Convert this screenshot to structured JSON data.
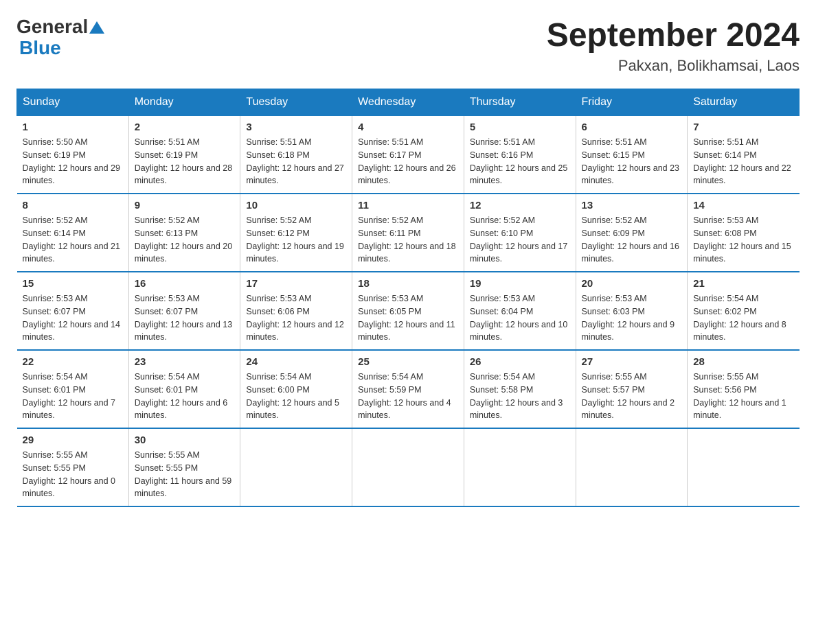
{
  "header": {
    "logo_general": "General",
    "logo_blue": "Blue",
    "title": "September 2024",
    "subtitle": "Pakxan, Bolikhamsai, Laos"
  },
  "days_of_week": [
    "Sunday",
    "Monday",
    "Tuesday",
    "Wednesday",
    "Thursday",
    "Friday",
    "Saturday"
  ],
  "weeks": [
    [
      {
        "day": "1",
        "sunrise": "5:50 AM",
        "sunset": "6:19 PM",
        "daylight": "12 hours and 29 minutes."
      },
      {
        "day": "2",
        "sunrise": "5:51 AM",
        "sunset": "6:19 PM",
        "daylight": "12 hours and 28 minutes."
      },
      {
        "day": "3",
        "sunrise": "5:51 AM",
        "sunset": "6:18 PM",
        "daylight": "12 hours and 27 minutes."
      },
      {
        "day": "4",
        "sunrise": "5:51 AM",
        "sunset": "6:17 PM",
        "daylight": "12 hours and 26 minutes."
      },
      {
        "day": "5",
        "sunrise": "5:51 AM",
        "sunset": "6:16 PM",
        "daylight": "12 hours and 25 minutes."
      },
      {
        "day": "6",
        "sunrise": "5:51 AM",
        "sunset": "6:15 PM",
        "daylight": "12 hours and 23 minutes."
      },
      {
        "day": "7",
        "sunrise": "5:51 AM",
        "sunset": "6:14 PM",
        "daylight": "12 hours and 22 minutes."
      }
    ],
    [
      {
        "day": "8",
        "sunrise": "5:52 AM",
        "sunset": "6:14 PM",
        "daylight": "12 hours and 21 minutes."
      },
      {
        "day": "9",
        "sunrise": "5:52 AM",
        "sunset": "6:13 PM",
        "daylight": "12 hours and 20 minutes."
      },
      {
        "day": "10",
        "sunrise": "5:52 AM",
        "sunset": "6:12 PM",
        "daylight": "12 hours and 19 minutes."
      },
      {
        "day": "11",
        "sunrise": "5:52 AM",
        "sunset": "6:11 PM",
        "daylight": "12 hours and 18 minutes."
      },
      {
        "day": "12",
        "sunrise": "5:52 AM",
        "sunset": "6:10 PM",
        "daylight": "12 hours and 17 minutes."
      },
      {
        "day": "13",
        "sunrise": "5:52 AM",
        "sunset": "6:09 PM",
        "daylight": "12 hours and 16 minutes."
      },
      {
        "day": "14",
        "sunrise": "5:53 AM",
        "sunset": "6:08 PM",
        "daylight": "12 hours and 15 minutes."
      }
    ],
    [
      {
        "day": "15",
        "sunrise": "5:53 AM",
        "sunset": "6:07 PM",
        "daylight": "12 hours and 14 minutes."
      },
      {
        "day": "16",
        "sunrise": "5:53 AM",
        "sunset": "6:07 PM",
        "daylight": "12 hours and 13 minutes."
      },
      {
        "day": "17",
        "sunrise": "5:53 AM",
        "sunset": "6:06 PM",
        "daylight": "12 hours and 12 minutes."
      },
      {
        "day": "18",
        "sunrise": "5:53 AM",
        "sunset": "6:05 PM",
        "daylight": "12 hours and 11 minutes."
      },
      {
        "day": "19",
        "sunrise": "5:53 AM",
        "sunset": "6:04 PM",
        "daylight": "12 hours and 10 minutes."
      },
      {
        "day": "20",
        "sunrise": "5:53 AM",
        "sunset": "6:03 PM",
        "daylight": "12 hours and 9 minutes."
      },
      {
        "day": "21",
        "sunrise": "5:54 AM",
        "sunset": "6:02 PM",
        "daylight": "12 hours and 8 minutes."
      }
    ],
    [
      {
        "day": "22",
        "sunrise": "5:54 AM",
        "sunset": "6:01 PM",
        "daylight": "12 hours and 7 minutes."
      },
      {
        "day": "23",
        "sunrise": "5:54 AM",
        "sunset": "6:01 PM",
        "daylight": "12 hours and 6 minutes."
      },
      {
        "day": "24",
        "sunrise": "5:54 AM",
        "sunset": "6:00 PM",
        "daylight": "12 hours and 5 minutes."
      },
      {
        "day": "25",
        "sunrise": "5:54 AM",
        "sunset": "5:59 PM",
        "daylight": "12 hours and 4 minutes."
      },
      {
        "day": "26",
        "sunrise": "5:54 AM",
        "sunset": "5:58 PM",
        "daylight": "12 hours and 3 minutes."
      },
      {
        "day": "27",
        "sunrise": "5:55 AM",
        "sunset": "5:57 PM",
        "daylight": "12 hours and 2 minutes."
      },
      {
        "day": "28",
        "sunrise": "5:55 AM",
        "sunset": "5:56 PM",
        "daylight": "12 hours and 1 minute."
      }
    ],
    [
      {
        "day": "29",
        "sunrise": "5:55 AM",
        "sunset": "5:55 PM",
        "daylight": "12 hours and 0 minutes."
      },
      {
        "day": "30",
        "sunrise": "5:55 AM",
        "sunset": "5:55 PM",
        "daylight": "11 hours and 59 minutes."
      },
      null,
      null,
      null,
      null,
      null
    ]
  ]
}
